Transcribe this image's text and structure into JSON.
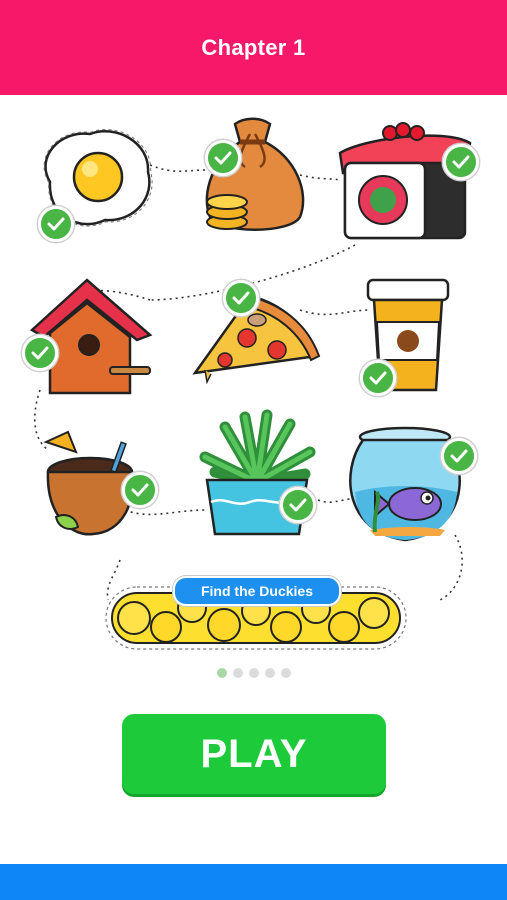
{
  "header": {
    "title": "Chapter 1",
    "color": "#f7186a"
  },
  "levels": [
    {
      "name": "fried-egg",
      "completed": true
    },
    {
      "name": "money-bag",
      "completed": true
    },
    {
      "name": "sushi-roll",
      "completed": true
    },
    {
      "name": "birdhouse",
      "completed": true
    },
    {
      "name": "pizza-slice",
      "completed": true
    },
    {
      "name": "coffee-cup",
      "completed": true
    },
    {
      "name": "coconut-drink",
      "completed": true
    },
    {
      "name": "potted-plant",
      "completed": true
    },
    {
      "name": "fishbowl",
      "completed": true
    }
  ],
  "next_level": {
    "label": "Find the Duckies",
    "color": "#1e90f0"
  },
  "pagination": {
    "total": 5,
    "active": 1
  },
  "play_button": {
    "label": "PLAY",
    "color": "#1dcb3a"
  },
  "footer": {
    "color": "#0f86f5"
  }
}
